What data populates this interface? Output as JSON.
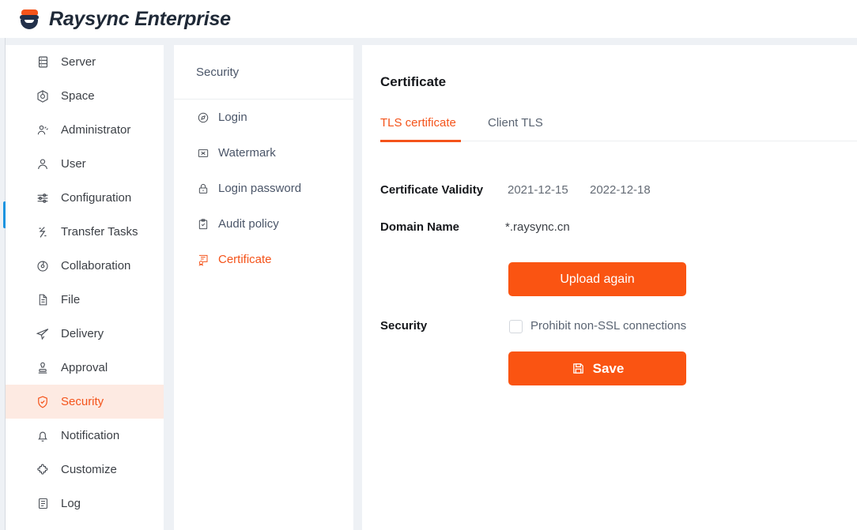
{
  "header": {
    "brand": "Raysync Enterprise",
    "logo_icon": "raysync-logo-icon"
  },
  "sidebar": {
    "items": [
      {
        "label": "Server",
        "icon": "server-icon",
        "active": false
      },
      {
        "label": "Space",
        "icon": "space-icon",
        "active": false
      },
      {
        "label": "Administrator",
        "icon": "administrator-icon",
        "active": false
      },
      {
        "label": "User",
        "icon": "user-icon",
        "active": false
      },
      {
        "label": "Configuration",
        "icon": "configuration-icon",
        "active": false
      },
      {
        "label": "Transfer Tasks",
        "icon": "transfer-tasks-icon",
        "active": false
      },
      {
        "label": "Collaboration",
        "icon": "collaboration-icon",
        "active": false
      },
      {
        "label": "File",
        "icon": "file-icon",
        "active": false
      },
      {
        "label": "Delivery",
        "icon": "delivery-icon",
        "active": false
      },
      {
        "label": "Approval",
        "icon": "approval-icon",
        "active": false
      },
      {
        "label": "Security",
        "icon": "shield-icon",
        "active": true
      },
      {
        "label": "Notification",
        "icon": "bell-icon",
        "active": false
      },
      {
        "label": "Customize",
        "icon": "puzzle-icon",
        "active": false
      },
      {
        "label": "Log",
        "icon": "log-icon",
        "active": false
      }
    ]
  },
  "submenu": {
    "title": "Security",
    "items": [
      {
        "label": "Login",
        "icon": "compass-icon",
        "active": false
      },
      {
        "label": "Watermark",
        "icon": "watermark-icon",
        "active": false
      },
      {
        "label": "Login password",
        "icon": "lock-icon",
        "active": false
      },
      {
        "label": "Audit policy",
        "icon": "clipboard-icon",
        "active": false
      },
      {
        "label": "Certificate",
        "icon": "certificate-icon",
        "active": true
      }
    ]
  },
  "main": {
    "title": "Certificate",
    "tabs": [
      {
        "label": "TLS certificate",
        "active": true
      },
      {
        "label": "Client TLS",
        "active": false
      }
    ],
    "fields": {
      "validity_label": "Certificate Validity",
      "validity_from": "2021-12-15",
      "validity_to": "2022-12-18",
      "domain_label": "Domain Name",
      "domain_value": "*.raysync.cn",
      "security_label": "Security",
      "checkbox_label": "Prohibit non-SSL connections",
      "checkbox_checked": false
    },
    "buttons": {
      "upload": "Upload again",
      "save": "Save",
      "save_icon": "floppy-save-icon"
    }
  },
  "colors": {
    "accent": "#f4531a",
    "button": "#fa5412",
    "active_bg": "#fdeae2",
    "page_bg": "#eef1f5",
    "scrollbar": "#1c94e0"
  }
}
